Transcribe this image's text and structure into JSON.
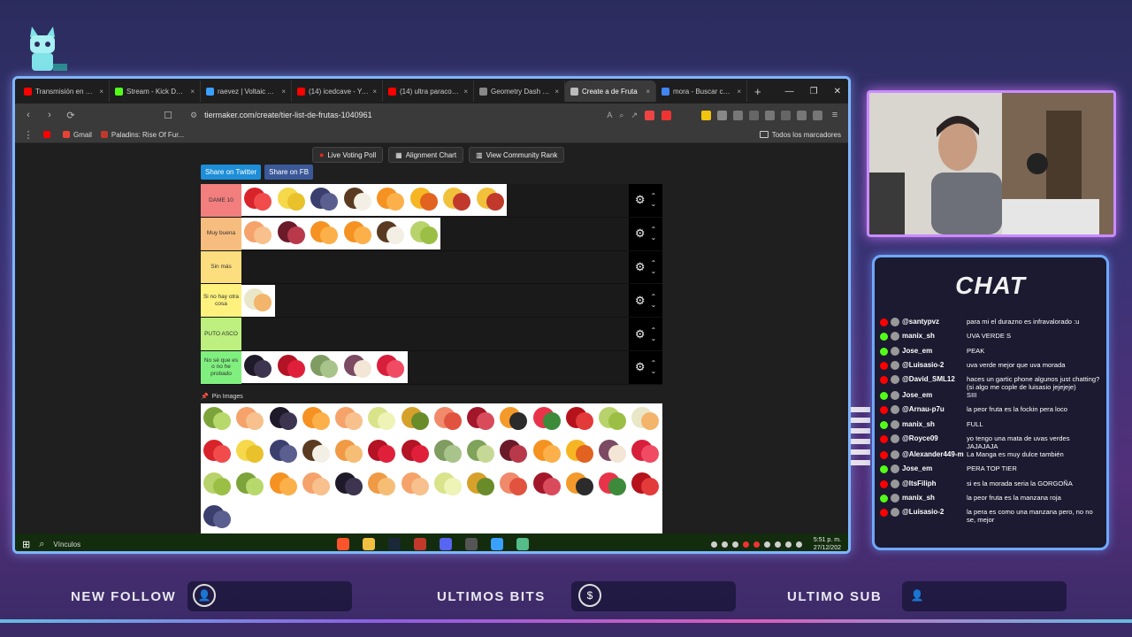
{
  "browser": {
    "tabs": [
      {
        "label": "Transmisión en vivo",
        "color": "#ff0000",
        "active": false
      },
      {
        "label": "Stream - Kick Dashbo",
        "color": "#53fc18",
        "active": false
      },
      {
        "label": "raevez | Voltaic App",
        "color": "#3aa0ff",
        "active": false
      },
      {
        "label": "(14) icedcave - YouTu",
        "color": "#ff0000",
        "active": false
      },
      {
        "label": "(14) ultra paracosm",
        "color": "#ff0000",
        "active": false
      },
      {
        "label": "Geometry Dash Dem",
        "color": "#888888",
        "active": false
      },
      {
        "label": "Create a de Fruta",
        "color": "#bbbbbb",
        "active": true
      },
      {
        "label": "mora - Buscar con Go",
        "color": "#4285f4",
        "active": false
      }
    ],
    "new_tab": "+",
    "url": "tiermaker.com/create/tier-list-de-frutas-1040961",
    "bookmarks": [
      {
        "label": "",
        "color": "#ff0000"
      },
      {
        "label": "Gmail",
        "color": "#ea4335"
      },
      {
        "label": "Paladins: Rise Of Fur...",
        "color": "#c0392b"
      }
    ],
    "bookmarks_right": "Todos los marcadores"
  },
  "page": {
    "buttons": [
      {
        "label": "Live Voting Poll",
        "icon": "red-dot-icon"
      },
      {
        "label": "Alignment Chart",
        "icon": "grid-icon"
      },
      {
        "label": "View Community Rank",
        "icon": "bars-icon"
      }
    ],
    "share_twitter": "Share on Twitter",
    "share_fb": "Share on FB",
    "tiers": [
      {
        "label": "DAME 10",
        "color": "#f27e7e",
        "fruits": [
          "strawberry",
          "banana",
          "blueberry",
          "coconut",
          "orange",
          "mango",
          "mixed",
          "mixed"
        ]
      },
      {
        "label": "Muy buena",
        "color": "#f7bd7e",
        "fruits": [
          "peach",
          "plum",
          "orange",
          "orange",
          "coconut",
          "grape"
        ]
      },
      {
        "label": "Sin más",
        "color": "#fdde7e",
        "fruits": []
      },
      {
        "label": "Si no hay otra cosa",
        "color": "#fef17e",
        "fruits": [
          "melon"
        ]
      },
      {
        "label": "PUTO ASCO",
        "color": "#bdf07e",
        "fruits": []
      },
      {
        "label": "No sé que es o no he probado",
        "color": "#7ff07e",
        "fruits": [
          "blackberry",
          "cherry",
          "custard",
          "fig",
          "raspberry"
        ]
      }
    ],
    "pin_label": "Pin Images",
    "pool": [
      "kiwi",
      "peach",
      "blackberry",
      "orange",
      "peach",
      "pear",
      "pineapple",
      "grapefruit",
      "pomegranate",
      "papaya",
      "watermelon",
      "apple",
      "grape",
      "melon",
      "strawberry",
      "banana",
      "blueberry",
      "coconut",
      "apricot",
      "cherry",
      "cherry",
      "custard",
      "guava",
      "plum",
      "orange",
      "mango",
      "fig",
      "raspberry",
      "grape",
      "kiwi",
      "orange",
      "peach",
      "blackberry",
      "apricot",
      "peach",
      "pear",
      "pineapple",
      "grapefruit",
      "pomegranate",
      "papaya",
      "watermelon",
      "apple",
      "blueberry"
    ]
  },
  "taskbar": {
    "search_label": "Vínculos",
    "time": "5:51 p. m.",
    "date": "27/12/202"
  },
  "chat": {
    "title": "CHAT",
    "messages": [
      {
        "platform": "youtube",
        "user": "@santypvz",
        "text": "para mi el durazno es infravalorado :u"
      },
      {
        "platform": "kick",
        "user": "manix_sh",
        "text": "UVA VERDE S"
      },
      {
        "platform": "kick",
        "user": "Jose_em",
        "text": "PEAK"
      },
      {
        "platform": "youtube",
        "user": "@Luisasio-2",
        "text": "uva verde mejor que uva morada"
      },
      {
        "platform": "youtube",
        "user": "@David_SML12",
        "text": "haces un gartic phone algunos just chatting? (si algo me cople de luisasio jejejeje)"
      },
      {
        "platform": "kick",
        "user": "Jose_em",
        "text": "SIII"
      },
      {
        "platform": "youtube",
        "user": "@Arnau-p7u",
        "text": "la peor fruta es la fockin pera loco"
      },
      {
        "platform": "kick",
        "user": "manix_sh",
        "text": "FULL"
      },
      {
        "platform": "youtube",
        "user": "@Royce09",
        "text": "yo tengo una mata de uvas verdes JAJAJAJA"
      },
      {
        "platform": "youtube",
        "user": "@Alexander449-m9x",
        "text": "La Manga es muy dulce también"
      },
      {
        "platform": "kick",
        "user": "Jose_em",
        "text": "PERA TOP TIER"
      },
      {
        "platform": "youtube",
        "user": "@ItsFiliph",
        "text": "si es la morada seria la GORGOÑA"
      },
      {
        "platform": "kick",
        "user": "manix_sh",
        "text": "la peor fruta es la manzana roja"
      },
      {
        "platform": "youtube",
        "user": "@Luisasio-2",
        "text": "la pera es como una manzana pero, no no se, mejor"
      }
    ]
  },
  "overlay": {
    "new_follow": "NEW FOLLOW",
    "ultimos_bits": "ULTIMOS BITS",
    "ultimo_sub": "ULTIMO SUB"
  },
  "colors": {
    "youtube": "#ff0000",
    "kick": "#53fc18",
    "frame_blue": "#7fb5ff",
    "frame_purple": "#c98cff"
  }
}
